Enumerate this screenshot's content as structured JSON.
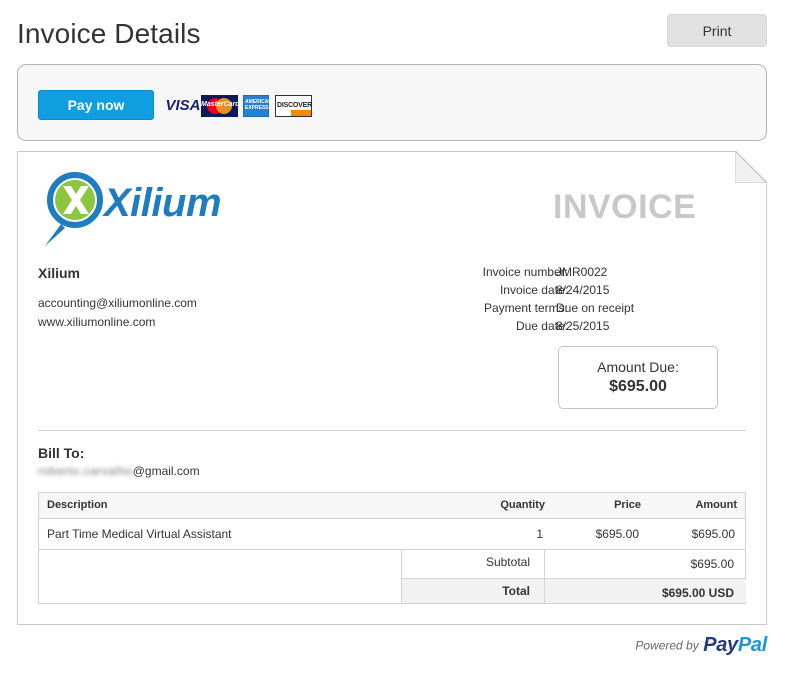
{
  "header": {
    "title": "Invoice Details",
    "print_label": "Print"
  },
  "payment": {
    "pay_now_label": "Pay now",
    "cards": [
      {
        "name": "visa-icon",
        "text": "VISA"
      },
      {
        "name": "mastercard-icon",
        "text": "MasterCard"
      },
      {
        "name": "amex-icon",
        "text": "AMERICAN EXPRESS"
      },
      {
        "name": "discover-icon",
        "text": "DISCOVER"
      }
    ]
  },
  "invoice": {
    "logo_text": "Xilium",
    "heading": "INVOICE",
    "seller": {
      "name": "Xilium",
      "email": "accounting@xiliumonline.com",
      "website": "www.xiliumonline.com"
    },
    "meta": [
      {
        "label": "Invoice number:",
        "value": "JMR0022"
      },
      {
        "label": "Invoice date:",
        "value": "8/24/2015"
      },
      {
        "label": "Payment terms:",
        "value": "Due on receipt"
      },
      {
        "label": "Due date:",
        "value": "8/25/2015"
      }
    ],
    "amount_due": {
      "label": "Amount Due:",
      "value": "$695.00"
    },
    "bill_to": {
      "label": "Bill To:",
      "email_hidden": "roberto.carvalho",
      "email_domain": "@gmail.com"
    },
    "table": {
      "headers": {
        "description": "Description",
        "quantity": "Quantity",
        "price": "Price",
        "amount": "Amount"
      },
      "rows": [
        {
          "description": "Part Time Medical Virtual Assistant",
          "quantity": "1",
          "price": "$695.00",
          "amount": "$695.00"
        }
      ],
      "subtotal_label": "Subtotal",
      "subtotal_value": "$695.00",
      "total_label": "Total",
      "total_value": "$695.00 USD"
    }
  },
  "footer": {
    "powered_by": "Powered by",
    "paypal_pay": "Pay",
    "paypal_pal": "Pal"
  },
  "colors": {
    "pay_button": "#0f9ee0",
    "logo_blue": "#1d7dbf",
    "logo_green": "#8cc63f",
    "paypal_dark": "#253b80",
    "paypal_light": "#179bd7"
  }
}
